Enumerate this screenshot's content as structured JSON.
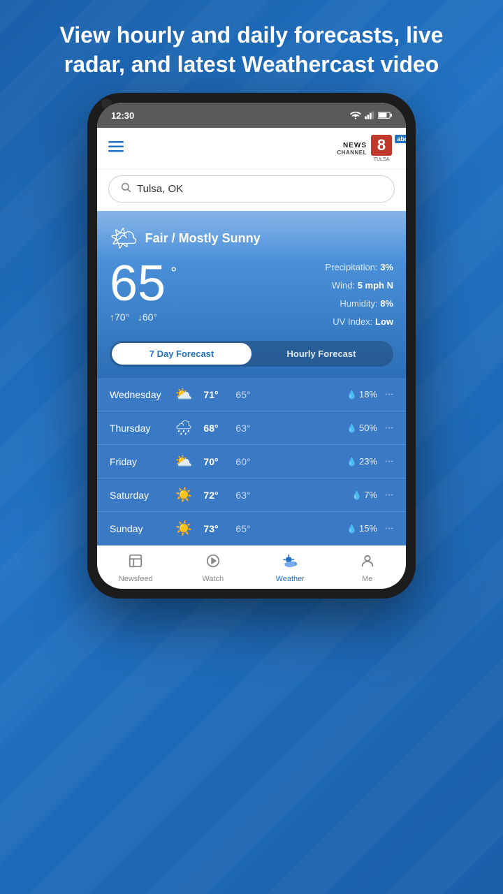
{
  "headline": "View hourly and daily forecasts, live radar, and latest Weathercast video",
  "status": {
    "time": "12:30"
  },
  "header": {
    "menu_label": "☰",
    "logo_news": "NEWS",
    "logo_channel": "CHANNEL",
    "logo_8": "8",
    "logo_abc": "abc",
    "logo_tulsa": "TULSA"
  },
  "search": {
    "placeholder": "Tulsa, OK",
    "value": "Tulsa, OK"
  },
  "weather": {
    "condition": "Fair / Mostly Sunny",
    "temperature": "65",
    "hi": "70°",
    "lo": "60°",
    "precipitation_label": "Precipitation:",
    "precipitation_value": "3%",
    "wind_label": "Wind:",
    "wind_value": "5 mph N",
    "humidity_label": "Humidity:",
    "humidity_value": "8%",
    "uv_label": "UV Index:",
    "uv_value": "Low"
  },
  "tabs": {
    "seven_day": "7 Day Forecast",
    "hourly": "Hourly Forecast"
  },
  "forecast": [
    {
      "day": "Wednesday",
      "icon": "⛅",
      "high": "71°",
      "low": "65°",
      "precip": "18%"
    },
    {
      "day": "Thursday",
      "icon": "🌧",
      "high": "68°",
      "low": "63°",
      "precip": "50%"
    },
    {
      "day": "Friday",
      "icon": "⛅",
      "high": "70°",
      "low": "60°",
      "precip": "23%"
    },
    {
      "day": "Saturday",
      "icon": "☀️",
      "high": "72°",
      "low": "63°",
      "precip": "7%"
    },
    {
      "day": "Sunday",
      "icon": "☀️",
      "high": "73°",
      "low": "65°",
      "precip": "15%"
    }
  ],
  "nav": {
    "newsfeed_label": "Newsfeed",
    "watch_label": "Watch",
    "weather_label": "Weather",
    "me_label": "Me"
  }
}
